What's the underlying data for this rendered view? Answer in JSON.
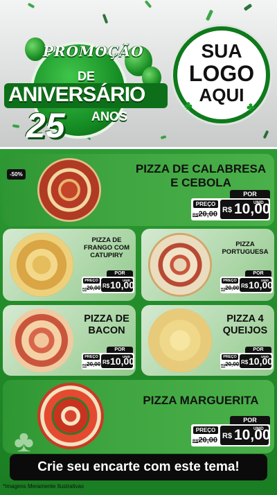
{
  "header": {
    "promo_top": "PROMOÇÃO",
    "promo_de": "DE",
    "promo_aniversario": "ANIVERSÁRIO",
    "promo_number": "25",
    "promo_anos": "ANOS",
    "logo_line1": "SUA",
    "logo_line2": "LOGO",
    "logo_line3": "AQUI"
  },
  "colors": {
    "brand_green": "#1a8f24",
    "dark": "#111111"
  },
  "products": [
    {
      "name_l1": "PIZZA DE CALABRESA",
      "name_l2": "E CEBOLA",
      "badge": "-50%",
      "por": "POR",
      "preco": "PREÇO",
      "old_currency": "R$",
      "old_value": "20,00",
      "currency": "R$",
      "value": "10,00",
      "unit": "UNID"
    },
    {
      "name_l1": "PIZZA DE",
      "name_l2": "FRANGO COM",
      "name_l3": "CATUPIRY",
      "por": "POR",
      "preco": "PREÇO",
      "old_currency": "R$",
      "old_value": "20,00",
      "currency": "R$",
      "value": "10,00",
      "unit": "UNID"
    },
    {
      "name_l1": "PIZZA",
      "name_l2": "PORTUGUESA",
      "por": "POR",
      "preco": "PREÇO",
      "old_currency": "R$",
      "old_value": "20,00",
      "currency": "R$",
      "value": "10,00",
      "unit": "UNID"
    },
    {
      "name_l1": "PIZZA DE",
      "name_l2": "BACON",
      "por": "POR",
      "preco": "PREÇO",
      "old_currency": "R$",
      "old_value": "20,00",
      "currency": "R$",
      "value": "10,00",
      "unit": "UNID"
    },
    {
      "name_l1": "PIZZA 4",
      "name_l2": "QUEIJOS",
      "por": "POR",
      "preco": "PREÇO",
      "old_currency": "R$",
      "old_value": "20,00",
      "currency": "R$",
      "value": "10,00",
      "unit": "UNID"
    },
    {
      "name_l1": "PIZZA MARGUERITA",
      "por": "POR",
      "preco": "PREÇO",
      "old_currency": "R$",
      "old_value": "20,00",
      "currency": "R$",
      "value": "10,00",
      "unit": "UNID"
    }
  ],
  "banner": "Crie seu encarte com este tema!",
  "disclaimer": "*Imagens Meramente Ilustrativas"
}
